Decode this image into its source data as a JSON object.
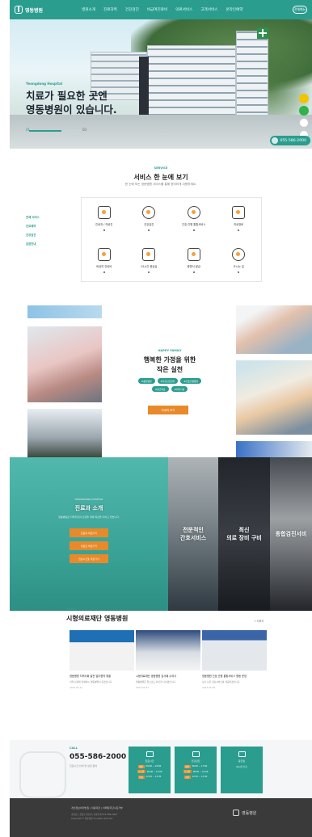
{
  "header": {
    "logo_text": "영동병원",
    "menu": [
      "병원소개",
      "진료과목",
      "건강검진",
      "비급여진료비",
      "의료서비스",
      "고객서비스",
      "온라인예약"
    ],
    "sitemap_label": "전체메뉴"
  },
  "hero": {
    "tag": "Yeongdong Hospital",
    "title_line1": "치료가 필요한 곳엔",
    "title_line2": "영동병원이 있습니다.",
    "counter_current": "01",
    "counter_total": "03",
    "phone": "055-586-2000"
  },
  "services": {
    "label": "SERVICE",
    "title": "서비스 한 눈에 보기",
    "subtitle": "한 눈에 보는 영동병원 서비스를 통해 편리하게 이용하세요.",
    "side_items": [
      "전체 서비스",
      "진료예약",
      "건강검진",
      "입원안내"
    ],
    "items": [
      {
        "name": "진료과 / 의료진",
        "icon": "clipboard-icon"
      },
      {
        "name": "건강검진",
        "icon": "stethoscope-icon"
      },
      {
        "name": "간호·간병 통합서비스",
        "icon": "nurse-icon"
      },
      {
        "name": "의료장비",
        "icon": "microscope-icon"
      },
      {
        "name": "비급여 진료비",
        "icon": "bill-icon"
      },
      {
        "name": "24시간 응급실",
        "icon": "ambulance-icon"
      },
      {
        "name": "증명서 발급",
        "icon": "document-icon"
      },
      {
        "name": "오시는 길",
        "icon": "location-icon"
      }
    ]
  },
  "family": {
    "label": "HAPPY FAMILY",
    "title_line1": "행복한 가정을 위한",
    "title_line2": "작은 실천",
    "tags": [
      "#종합병원",
      "#건강검진센터",
      "#간호간병통합",
      "#응급의료",
      "#지역거점"
    ],
    "button": "자세히 보기"
  },
  "intro": {
    "panel1": {
      "small": "YEONGDONG HOSPITAL",
      "title": "진료과 소개",
      "desc": "영동병원은 지역주민의 건강을 위해 최선을 다하고 있습니다.",
      "buttons": [
        "진료과 바로가기",
        "의료진 바로가기",
        "진료시간표 바로가기"
      ]
    },
    "panel2": {
      "title_line1": "전문적인",
      "title_line2": "간호서비스"
    },
    "panel3": {
      "title_line1": "최신",
      "title_line2": "의료 장비 구비"
    },
    "panel4": {
      "title": "종합검진서비"
    }
  },
  "news": {
    "label": "NEWS",
    "title": "시형의료재단 영동병원",
    "more": "+ 더보기",
    "items": [
      {
        "title": "영동병원 지역사회 발전 업무협약 체결",
        "desc": "지역 사회와 함께하는 영동병원이 되겠습니다.",
        "date": "2023.05.12"
      },
      {
        "title": "시형의료재단 영동병원 감사패 수여식",
        "desc": "영동병원은 앞으로도 최선을 다하겠습니다.",
        "date": "2023.04.21"
      },
      {
        "title": "영동병원 간호·간병 통합서비스 병동 운영",
        "desc": "보다 나은 의료서비스를 제공하겠습니다.",
        "date": "2023.03.08"
      }
    ]
  },
  "contact": {
    "label": "CALL",
    "phone": "055-586-2000",
    "note": "진료시간 안내 및 상담 문의",
    "tiles": [
      {
        "label": "진료시간",
        "icon": "calendar-icon",
        "rows": [
          {
            "tag": "평일",
            "text": "09:00 ~ 18:00"
          },
          {
            "tag": "토요일",
            "text": "09:00 ~ 13:00"
          },
          {
            "tag": "점심",
            "text": "12:30 ~ 13:30"
          }
        ]
      },
      {
        "label": "건강검진",
        "icon": "heart-icon",
        "rows": [
          {
            "tag": "평일",
            "text": "08:00 ~ 17:00"
          },
          {
            "tag": "토요일",
            "text": "08:00 ~ 12:00"
          },
          {
            "tag": "점심",
            "text": "12:30 ~ 13:30"
          }
        ]
      },
      {
        "label": "응급실",
        "icon": "emergency-icon",
        "rows": [
          {
            "tag": "",
            "text": "24시간 진료"
          }
        ]
      }
    ]
  },
  "footer": {
    "links": "개인정보처리방침 | 이용약관 | 이메일무단수집거부",
    "info_line1": "경상남도 창녕군 영산면 | 대표전화 055-586-2000",
    "info_line2": "Copyright © 영동병원 All rights reserved.",
    "logo_text": "영동병원"
  },
  "colors": {
    "accent": "#2a9d8f",
    "orange": "#e88a2a",
    "footer": "#3a3a3a"
  }
}
